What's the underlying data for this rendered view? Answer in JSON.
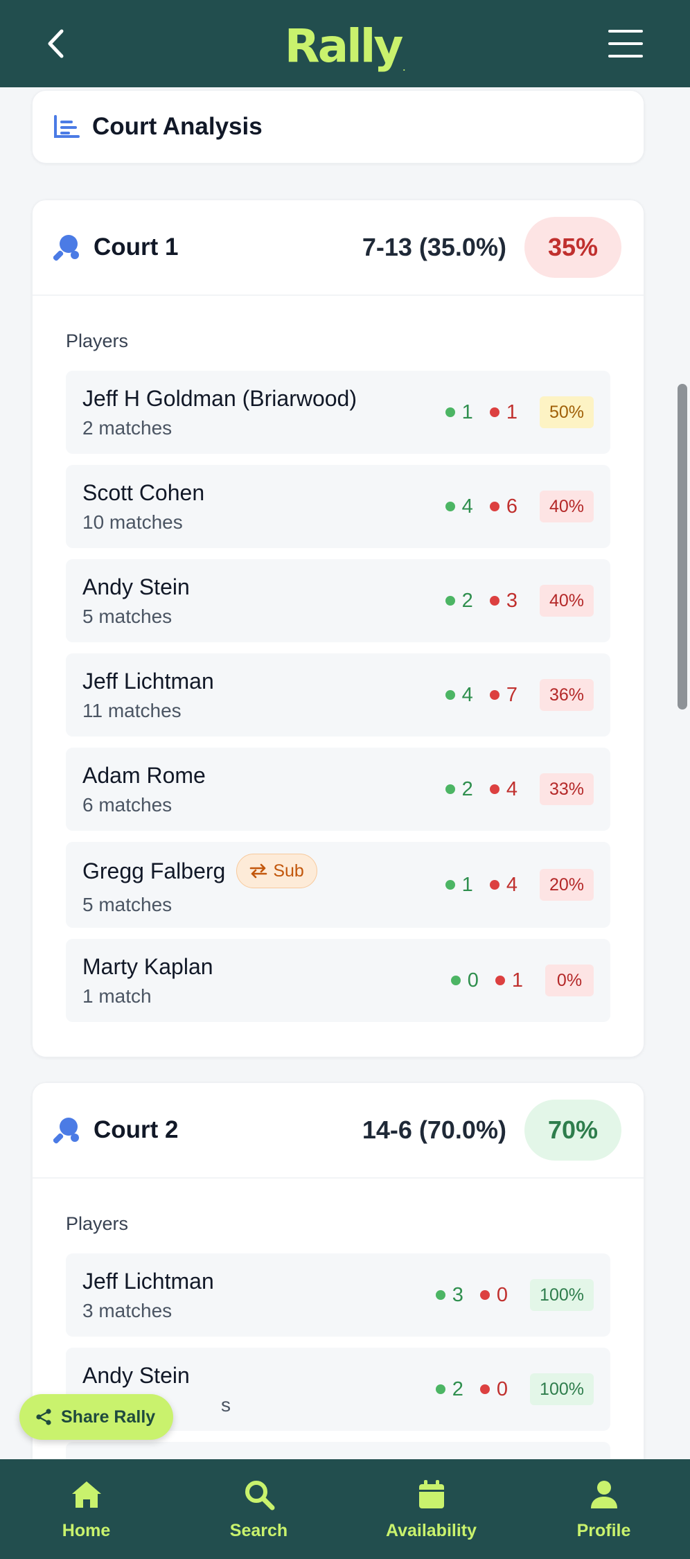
{
  "app": {
    "logo_text": "Rally",
    "logo_dot": "."
  },
  "analysis": {
    "title": "Court Analysis"
  },
  "courts": [
    {
      "name": "Court 1",
      "record": "7-13 (35.0%)",
      "badge": "35%",
      "players_label": "Players",
      "players": [
        {
          "name": "Jeff H Goldman (Briarwood)",
          "matches": "2 matches",
          "wins": "1",
          "losses": "1",
          "pct": "50%"
        },
        {
          "name": "Scott Cohen",
          "matches": "10 matches",
          "wins": "4",
          "losses": "6",
          "pct": "40%"
        },
        {
          "name": "Andy Stein",
          "matches": "5 matches",
          "wins": "2",
          "losses": "3",
          "pct": "40%"
        },
        {
          "name": "Jeff Lichtman",
          "matches": "11 matches",
          "wins": "4",
          "losses": "7",
          "pct": "36%"
        },
        {
          "name": "Adam Rome",
          "matches": "6 matches",
          "wins": "2",
          "losses": "4",
          "pct": "33%"
        },
        {
          "name": "Gregg Falberg",
          "sub": "Sub",
          "matches": "5 matches",
          "wins": "1",
          "losses": "4",
          "pct": "20%"
        },
        {
          "name": "Marty Kaplan",
          "matches": "1 match",
          "wins": "0",
          "losses": "1",
          "pct": "0%"
        }
      ]
    },
    {
      "name": "Court 2",
      "record": "14-6 (70.0%)",
      "badge": "70%",
      "players_label": "Players",
      "players": [
        {
          "name": "Jeff Lichtman",
          "matches": "3 matches",
          "wins": "3",
          "losses": "0",
          "pct": "100%"
        },
        {
          "name": "Andy Stein",
          "matches": "s",
          "wins": "2",
          "losses": "0",
          "pct": "100%"
        }
      ]
    }
  ],
  "share": {
    "label": "Share Rally"
  },
  "nav": [
    {
      "label": "Home",
      "icon": "home-icon"
    },
    {
      "label": "Search",
      "icon": "search-icon"
    },
    {
      "label": "Availability",
      "icon": "calendar-icon"
    },
    {
      "label": "Profile",
      "icon": "profile-icon"
    }
  ],
  "colors": {
    "header_bg": "#224e4e",
    "accent": "#c9f26d",
    "win": "#4cb564",
    "loss": "#dc4040"
  }
}
